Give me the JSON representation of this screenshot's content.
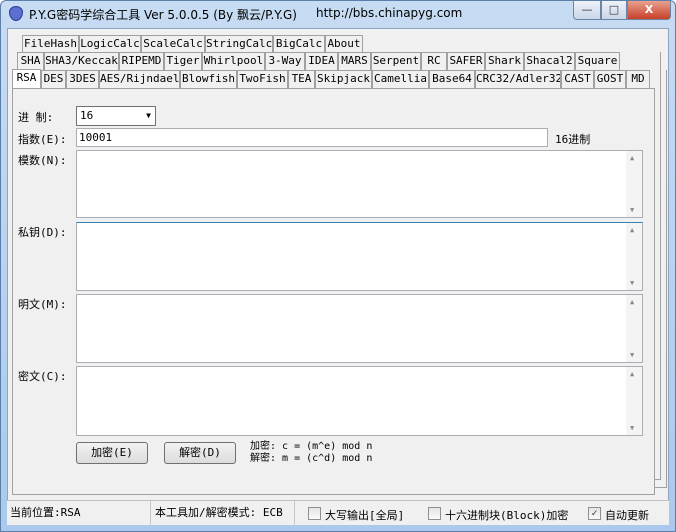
{
  "window": {
    "title": "P.Y.G密码学综合工具 Ver 5.0.0.5 (By 飘云/P.Y.G)",
    "url": "http://bbs.chinapyg.com",
    "minimize": "—",
    "maximize": "□",
    "close": "X"
  },
  "tabs": {
    "row1": [
      "FileHash",
      "LogicCalc",
      "ScaleCalc",
      "StringCalc",
      "BigCalc",
      "About"
    ],
    "row2": [
      "SHA",
      "SHA3/Keccak",
      "RIPEMD",
      "Tiger",
      "Whirlpool",
      "3-Way",
      "IDEA",
      "MARS",
      "Serpent",
      "RC",
      "SAFER",
      "Shark",
      "Shacal2",
      "Square"
    ],
    "row3": [
      "RSA",
      "DES",
      "3DES",
      "AES/Rijndael",
      "Blowfish",
      "TwoFish",
      "TEA",
      "Skipjack",
      "Camellia",
      "Base64",
      "CRC32/Adler32",
      "CAST",
      "GOST",
      "MD"
    ],
    "selected": "RSA"
  },
  "rsa": {
    "radix_label": "进  制:",
    "radix_value": "16",
    "exponent_label": "指数(E):",
    "exponent_value": "10001",
    "exponent_unit": "16进制",
    "modulus_label": "模数(N):",
    "modulus_value": "",
    "private_key_label": "私钥(D):",
    "private_key_value": "",
    "plaintext_label": "明文(M):",
    "plaintext_value": "",
    "ciphertext_label": "密文(C):",
    "ciphertext_value": "",
    "encrypt_button": "加密(E)",
    "decrypt_button": "解密(D)",
    "formula_encrypt": "加密: c = (m^e) mod n",
    "formula_decrypt": "解密: m = (c^d) mod n"
  },
  "status": {
    "location": "当前位置:RSA",
    "mode": "本工具加/解密模式: ECB",
    "uppercase": {
      "label": "大写输出[全局]",
      "checked": false
    },
    "hex_block": {
      "label": "十六进制块(Block)加密",
      "checked": false
    },
    "auto_update": {
      "label": "自动更新",
      "checked": true
    }
  }
}
